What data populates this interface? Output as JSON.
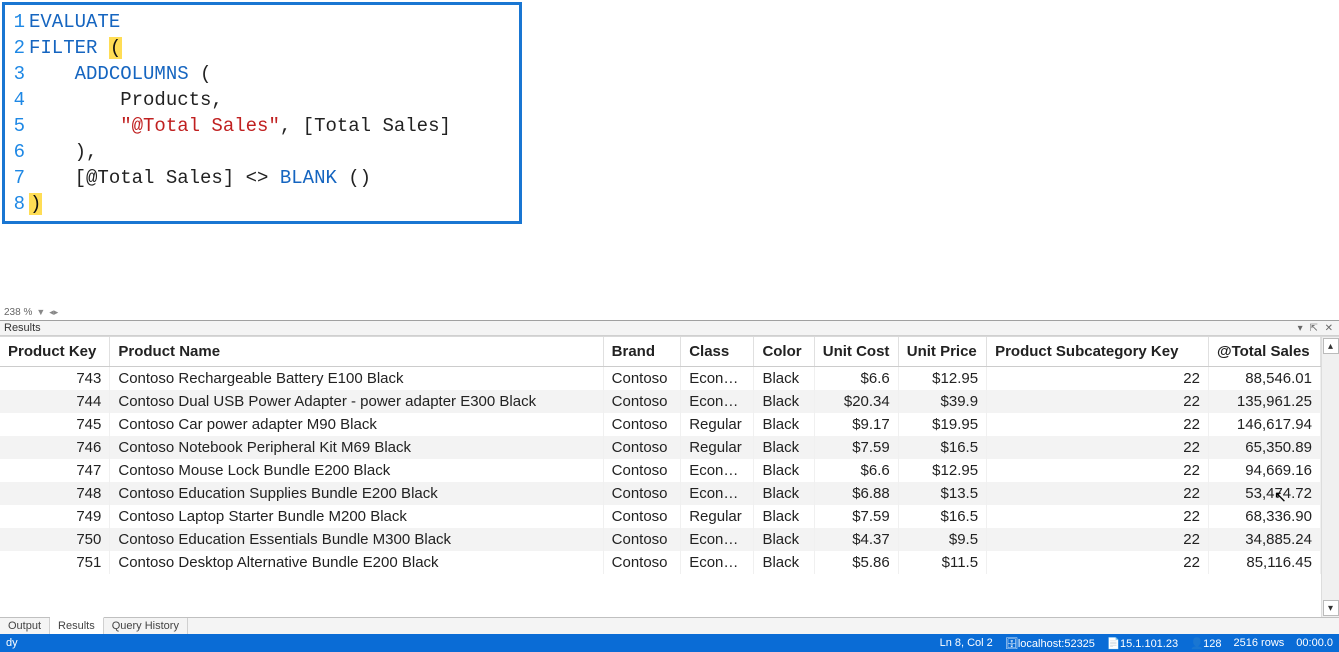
{
  "editor": {
    "zoom_label": "238 %",
    "lines": [
      {
        "n": 1,
        "tokens": [
          {
            "t": "EVALUATE",
            "c": "kw"
          }
        ]
      },
      {
        "n": 2,
        "tokens": [
          {
            "t": "FILTER",
            "c": "fn"
          },
          {
            "t": " ",
            "c": "text"
          },
          {
            "t": "(",
            "c": "paren-y"
          }
        ]
      },
      {
        "n": 3,
        "tokens": [
          {
            "t": "    ",
            "c": "text"
          },
          {
            "t": "ADDCOLUMNS",
            "c": "fn"
          },
          {
            "t": " (",
            "c": "text"
          }
        ]
      },
      {
        "n": 4,
        "tokens": [
          {
            "t": "        Products,",
            "c": "text"
          }
        ]
      },
      {
        "n": 5,
        "tokens": [
          {
            "t": "        ",
            "c": "text"
          },
          {
            "t": "\"@Total Sales\"",
            "c": "str"
          },
          {
            "t": ", [Total Sales]",
            "c": "text"
          }
        ]
      },
      {
        "n": 6,
        "tokens": [
          {
            "t": "    ),",
            "c": "text"
          }
        ]
      },
      {
        "n": 7,
        "tokens": [
          {
            "t": "    [@Total Sales] ",
            "c": "text"
          },
          {
            "t": "<>",
            "c": "op"
          },
          {
            "t": " ",
            "c": "text"
          },
          {
            "t": "BLANK",
            "c": "fn"
          },
          {
            "t": " ()",
            "c": "text"
          }
        ]
      },
      {
        "n": 8,
        "tokens": [
          {
            "t": ")",
            "c": "paren-y"
          }
        ]
      }
    ]
  },
  "results": {
    "panel_label": "Results",
    "pins_label": "▾ ⇱ ✕",
    "columns": [
      "Product Key",
      "Product Name",
      "Brand",
      "Class",
      "Color",
      "Unit Cost",
      "Unit Price",
      "Product Subcategory Key",
      "@Total Sales"
    ],
    "numeric_columns": [
      0,
      5,
      6,
      7,
      8
    ],
    "rows": [
      [
        "743",
        "Contoso Rechargeable Battery E100 Black",
        "Contoso",
        "Economy",
        "Black",
        "$6.6",
        "$12.95",
        "22",
        "88,546.01"
      ],
      [
        "744",
        "Contoso Dual USB Power Adapter - power adapter E300 Black",
        "Contoso",
        "Economy",
        "Black",
        "$20.34",
        "$39.9",
        "22",
        "135,961.25"
      ],
      [
        "745",
        "Contoso Car power adapter M90 Black",
        "Contoso",
        "Regular",
        "Black",
        "$9.17",
        "$19.95",
        "22",
        "146,617.94"
      ],
      [
        "746",
        "Contoso Notebook Peripheral Kit M69 Black",
        "Contoso",
        "Regular",
        "Black",
        "$7.59",
        "$16.5",
        "22",
        "65,350.89"
      ],
      [
        "747",
        "Contoso Mouse Lock Bundle E200 Black",
        "Contoso",
        "Economy",
        "Black",
        "$6.6",
        "$12.95",
        "22",
        "94,669.16"
      ],
      [
        "748",
        "Contoso Education Supplies Bundle E200 Black",
        "Contoso",
        "Economy",
        "Black",
        "$6.88",
        "$13.5",
        "22",
        "53,474.72"
      ],
      [
        "749",
        "Contoso Laptop Starter Bundle M200 Black",
        "Contoso",
        "Regular",
        "Black",
        "$7.59",
        "$16.5",
        "22",
        "68,336.90"
      ],
      [
        "750",
        "Contoso Education Essentials Bundle M300 Black",
        "Contoso",
        "Economy",
        "Black",
        "$4.37",
        "$9.5",
        "22",
        "34,885.24"
      ],
      [
        "751",
        "Contoso Desktop Alternative Bundle E200 Black",
        "Contoso",
        "Economy",
        "Black",
        "$5.86",
        "$11.5",
        "22",
        "85,116.45"
      ]
    ]
  },
  "tabs": {
    "items": [
      "Output",
      "Results",
      "Query History"
    ],
    "active_index": 1
  },
  "status": {
    "left": "dy",
    "cursor_pos": "Ln 8, Col 2",
    "server": "localhost:52325",
    "version": "15.1.101.23",
    "connections": "128",
    "rows": "2516 rows",
    "time": "00:00.0"
  }
}
